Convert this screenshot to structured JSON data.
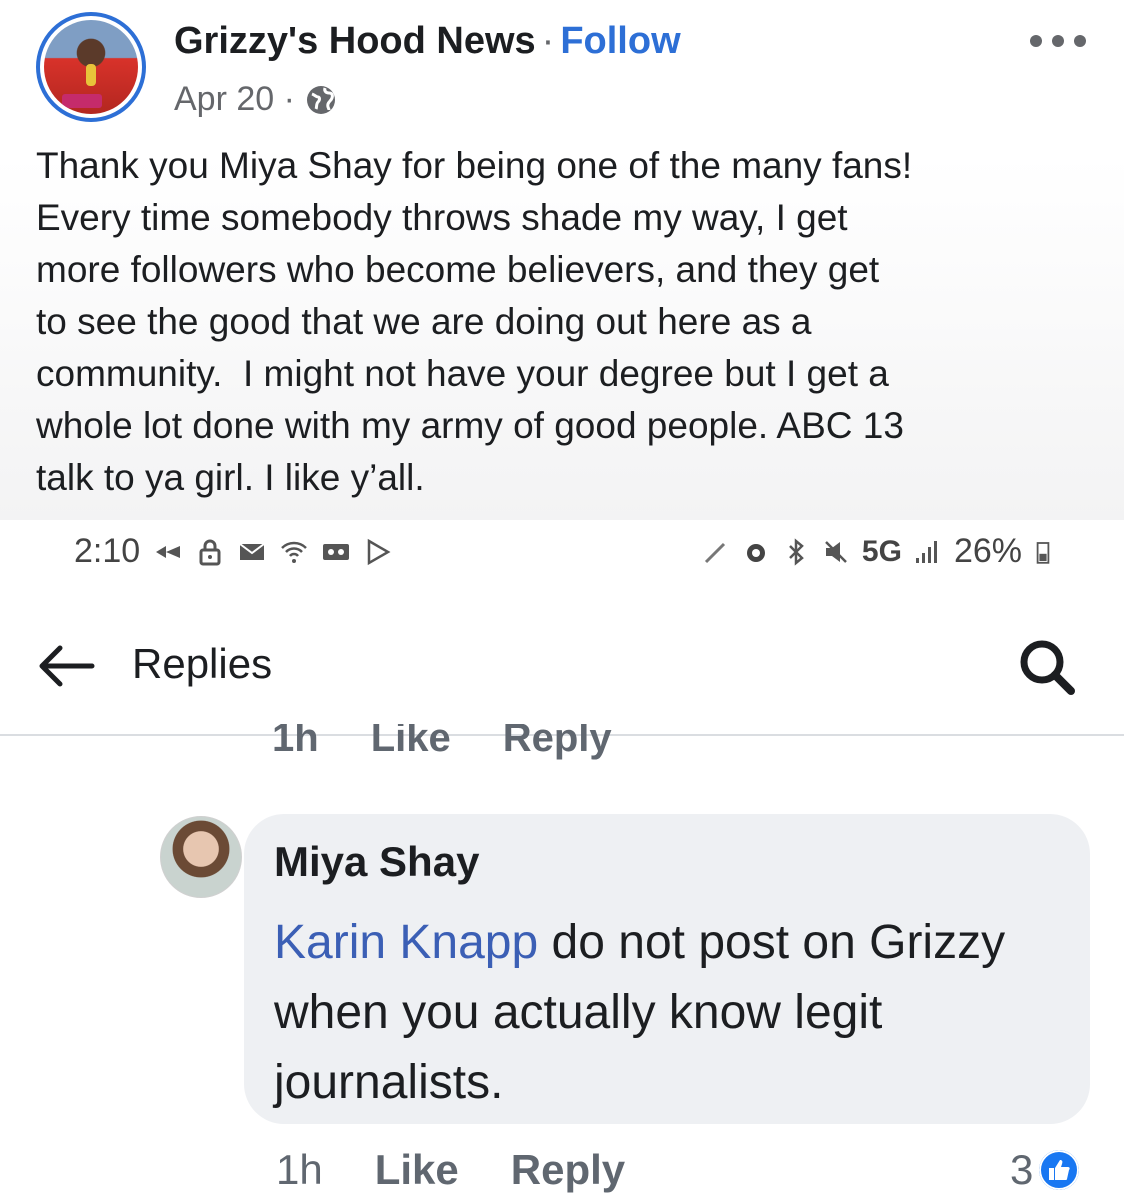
{
  "post": {
    "page_name": "Grizzy's Hood News",
    "separator": "·",
    "follow_label": "Follow",
    "date": "Apr 20 ·",
    "body": "Thank you Miya Shay for being one of the many fans!\nEvery time somebody throws shade my way, I get\nmore followers who become believers, and they get\nto see the good that we are doing out here as a\ncommunity.  I might not have your degree but I get a\nwhole lot done with my army of good people. ABC 13\ntalk to ya girl. I like y’all.",
    "more_icon": "more-horizontal-icon",
    "audience_icon": "globe-icon"
  },
  "status_bar": {
    "time": "2:10",
    "network": "5G",
    "battery": "26%"
  },
  "app_header": {
    "title": "Replies",
    "back_icon": "arrow-left-icon",
    "search_icon": "search-icon"
  },
  "previous_comment_actions": {
    "time": "1h",
    "like": "Like",
    "reply": "Reply"
  },
  "comment": {
    "author": "Miya Shay",
    "mention": "Karin Knapp",
    "text_after_mention": " do not post on Grizzy when you actually know legit journalists.",
    "time": "1h",
    "like": "Like",
    "reply": "Reply",
    "reaction_count": "3"
  },
  "colors": {
    "accent": "#2d6fd6",
    "mention": "#3b5fb5",
    "like_badge": "#1877f2",
    "bubble": "#eef0f3"
  }
}
